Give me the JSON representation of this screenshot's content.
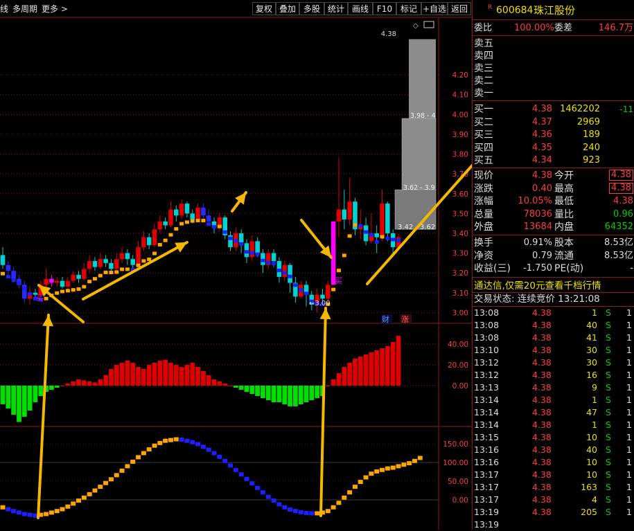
{
  "toolbar": {
    "left_items": [
      "线",
      "多周期",
      "更多 >"
    ],
    "buttons": [
      "复权",
      "叠加",
      "多股",
      "统计",
      "画线",
      "F10",
      "标记",
      "+自选",
      "返回"
    ]
  },
  "stock": {
    "code": "600684",
    "name": "珠江股份",
    "badge": "R"
  },
  "colors": {
    "up": "#ff3c3c",
    "down": "#00d2d2",
    "ma": "#ffa500",
    "macd_up": "#e00000",
    "macd_down": "#00e000",
    "grid": "#8b1a1a"
  },
  "order_book": {
    "weibi_label": "委比",
    "weibi_value": "100.00%",
    "weicha_label": "委差",
    "weicha_value": "146.7万",
    "sells": [
      "卖五",
      "卖四",
      "卖三",
      "卖二",
      "卖一"
    ],
    "buys": [
      {
        "label": "买一",
        "price": "4.38",
        "vol": "1462202",
        "chg": "-11"
      },
      {
        "label": "买二",
        "price": "4.37",
        "vol": "2969",
        "chg": ""
      },
      {
        "label": "买三",
        "price": "4.36",
        "vol": "189",
        "chg": ""
      },
      {
        "label": "买四",
        "price": "4.35",
        "vol": "240",
        "chg": ""
      },
      {
        "label": "买五",
        "price": "4.34",
        "vol": "923",
        "chg": ""
      }
    ]
  },
  "quote": [
    {
      "l1": "现价",
      "v1": "4.38",
      "l2": "今开",
      "v2": "4.38"
    },
    {
      "l1": "涨跌",
      "v1": "0.40",
      "l2": "最高",
      "v2": "4.38"
    },
    {
      "l1": "涨幅",
      "v1": "10.05%",
      "l2": "最低",
      "v2": "4.38"
    },
    {
      "l1": "总量",
      "v1": "78036",
      "l2": "量比",
      "v2": "0.96"
    },
    {
      "l1": "外盘",
      "v1": "13684",
      "l2": "内盘",
      "v2": "64352"
    },
    {
      "l1": "换手",
      "v1": "0.91%",
      "l2": "股本",
      "v2": "8.53亿"
    },
    {
      "l1": "净资",
      "v1": "0.79",
      "l2": "流通",
      "v2": "8.53亿"
    },
    {
      "l1": "收益(三)",
      "v1": "-1.750",
      "l2": "PE(动)",
      "v2": "-"
    }
  ],
  "ad_text": "通达信,仅需20元查看千档行情",
  "trade_status": "交易状态: 连续竞价 13:21:08",
  "ticks": [
    [
      "13:08",
      "4.38",
      "1",
      "S",
      "1"
    ],
    [
      "13:08",
      "4.38",
      "40",
      "S",
      "1"
    ],
    [
      "13:08",
      "4.38",
      "41",
      "S",
      "1"
    ],
    [
      "13:10",
      "4.38",
      "30",
      "S",
      "1"
    ],
    [
      "13:12",
      "4.38",
      "30",
      "S",
      "1"
    ],
    [
      "13:12",
      "4.38",
      "16",
      "S",
      "1"
    ],
    [
      "13:13",
      "4.38",
      "9",
      "S",
      "1"
    ],
    [
      "13:14",
      "4.38",
      "1",
      "S",
      "1"
    ],
    [
      "13:14",
      "4.38",
      "47",
      "S",
      "1"
    ],
    [
      "13:14",
      "4.38",
      "1",
      "S",
      "1"
    ],
    [
      "13:15",
      "4.38",
      "10",
      "S",
      "1"
    ],
    [
      "13:16",
      "4.38",
      "40",
      "S",
      "1"
    ],
    [
      "13:16",
      "4.38",
      "10",
      "S",
      "1"
    ],
    [
      "13:17",
      "4.38",
      "10",
      "S",
      "1"
    ],
    [
      "13:17",
      "4.38",
      "163",
      "S",
      "1"
    ],
    [
      "13:17",
      "4.38",
      "4",
      "S",
      "1"
    ],
    [
      "13:19",
      "4.38",
      "205",
      "S",
      "1"
    ],
    [
      "13:19",
      "",
      "",
      "",
      ""
    ]
  ],
  "chart_data": {
    "type": "candlestick",
    "price_ticks": [
      "4.20",
      "4.10",
      "4.00",
      "3.90",
      "3.80",
      "3.70",
      "3.60",
      "3.50",
      "3.40",
      "3.30",
      "3.20",
      "3.10",
      "3.00"
    ],
    "price_range": [
      2.97,
      4.48
    ],
    "labels": {
      "high": "4.38",
      "low": "3.00",
      "level1": "3.42",
      "level2": "3.62",
      "band1": "3.98 - 4",
      "band2": "3.62 - 3.9",
      "buy_mark": "买",
      "fin_mark": "财",
      "limit_mark": "涨"
    },
    "candles": [
      [
        3.29,
        3.24,
        3.33,
        3.22
      ],
      [
        3.24,
        3.21,
        3.26,
        3.18
      ],
      [
        3.21,
        3.17,
        3.23,
        3.15
      ],
      [
        3.17,
        3.14,
        3.19,
        3.12
      ],
      [
        3.14,
        3.07,
        3.16,
        3.05
      ],
      [
        3.07,
        3.1,
        3.13,
        3.04
      ],
      [
        3.1,
        3.09,
        3.12,
        3.07
      ],
      [
        3.09,
        3.14,
        3.16,
        3.08
      ],
      [
        3.14,
        3.17,
        3.22,
        3.12
      ],
      [
        3.17,
        3.15,
        3.19,
        3.13
      ],
      [
        3.15,
        3.16,
        3.18,
        3.13
      ],
      [
        3.16,
        3.13,
        3.18,
        3.12
      ],
      [
        3.13,
        3.16,
        3.18,
        3.11
      ],
      [
        3.16,
        3.19,
        3.21,
        3.15
      ],
      [
        3.19,
        3.17,
        3.21,
        3.15
      ],
      [
        3.17,
        3.22,
        3.25,
        3.16
      ],
      [
        3.22,
        3.26,
        3.29,
        3.2
      ],
      [
        3.26,
        3.23,
        3.28,
        3.21
      ],
      [
        3.23,
        3.27,
        3.3,
        3.22
      ],
      [
        3.27,
        3.25,
        3.29,
        3.23
      ],
      [
        3.25,
        3.22,
        3.27,
        3.2
      ],
      [
        3.22,
        3.27,
        3.3,
        3.21
      ],
      [
        3.27,
        3.3,
        3.33,
        3.25
      ],
      [
        3.3,
        3.27,
        3.32,
        3.24
      ],
      [
        3.27,
        3.24,
        3.29,
        3.22
      ],
      [
        3.24,
        3.33,
        3.36,
        3.23
      ],
      [
        3.33,
        3.38,
        3.41,
        3.31
      ],
      [
        3.38,
        3.34,
        3.4,
        3.32
      ],
      [
        3.34,
        3.42,
        3.45,
        3.33
      ],
      [
        3.42,
        3.46,
        3.49,
        3.4
      ],
      [
        3.46,
        3.44,
        3.48,
        3.42
      ],
      [
        3.44,
        3.52,
        3.56,
        3.43
      ],
      [
        3.52,
        3.49,
        3.54,
        3.46
      ],
      [
        3.49,
        3.55,
        3.57,
        3.47
      ],
      [
        3.55,
        3.5,
        3.56,
        3.48
      ],
      [
        3.5,
        3.47,
        3.52,
        3.45
      ],
      [
        3.47,
        3.53,
        3.55,
        3.46
      ],
      [
        3.53,
        3.49,
        3.55,
        3.47
      ],
      [
        3.49,
        3.46,
        3.52,
        3.44
      ],
      [
        3.46,
        3.43,
        3.48,
        3.4
      ],
      [
        3.43,
        3.48,
        3.5,
        3.41
      ],
      [
        3.48,
        3.39,
        3.49,
        3.37
      ],
      [
        3.39,
        3.33,
        3.41,
        3.31
      ],
      [
        3.33,
        3.4,
        3.43,
        3.31
      ],
      [
        3.4,
        3.35,
        3.42,
        3.3
      ],
      [
        3.35,
        3.28,
        3.37,
        3.25
      ],
      [
        3.28,
        3.36,
        3.39,
        3.26
      ],
      [
        3.36,
        3.3,
        3.38,
        3.28
      ],
      [
        3.3,
        3.24,
        3.32,
        3.2
      ],
      [
        3.24,
        3.3,
        3.32,
        3.22
      ],
      [
        3.3,
        3.26,
        3.32,
        3.23
      ],
      [
        3.26,
        3.18,
        3.28,
        3.15
      ],
      [
        3.18,
        3.24,
        3.26,
        3.16
      ],
      [
        3.24,
        3.15,
        3.25,
        3.1
      ],
      [
        3.15,
        3.08,
        3.18,
        3.05
      ],
      [
        3.08,
        3.14,
        3.16,
        3.07
      ],
      [
        3.14,
        3.09,
        3.16,
        3.03
      ],
      [
        3.09,
        3.04,
        3.11,
        3.01
      ],
      [
        3.04,
        3.09,
        3.12,
        3.0
      ],
      [
        3.09,
        3.07,
        3.12,
        3.04
      ],
      [
        3.07,
        3.14,
        3.16,
        3.06
      ],
      [
        3.14,
        3.46,
        3.46,
        3.14
      ],
      [
        3.46,
        3.52,
        3.78,
        3.38
      ],
      [
        3.52,
        3.47,
        3.62,
        3.42
      ],
      [
        3.47,
        3.56,
        3.68,
        3.44
      ],
      [
        3.56,
        3.42,
        3.58,
        3.39
      ],
      [
        3.42,
        3.44,
        3.52,
        3.37
      ],
      [
        3.44,
        3.36,
        3.48,
        3.34
      ],
      [
        3.36,
        3.4,
        3.5,
        3.35
      ],
      [
        3.4,
        3.38,
        3.44,
        3.3
      ],
      [
        3.38,
        3.55,
        3.62,
        3.36
      ],
      [
        3.55,
        3.4,
        3.56,
        3.36
      ],
      [
        3.4,
        3.33,
        3.42,
        3.28
      ],
      [
        3.33,
        3.38,
        3.4,
        3.32
      ]
    ],
    "macd_ticks": [
      "40.00",
      "20.00",
      "0.00"
    ],
    "macd": [
      -18,
      -22,
      -28,
      -35,
      -30,
      -24,
      -16,
      -10,
      -6,
      -4,
      -2,
      0,
      2,
      4,
      6,
      5,
      4,
      3,
      6,
      10,
      16,
      20,
      22,
      24,
      22,
      18,
      16,
      20,
      22,
      24,
      25,
      22,
      20,
      18,
      20,
      22,
      18,
      14,
      10,
      6,
      4,
      2,
      0,
      -2,
      -4,
      -6,
      -8,
      -10,
      -12,
      -14,
      -16,
      -16,
      -18,
      -20,
      -20,
      -18,
      -16,
      -14,
      -12,
      -10,
      0,
      6,
      12,
      18,
      22,
      26,
      28,
      30,
      32,
      34,
      36,
      38,
      42,
      48
    ],
    "osc_ticks": [
      "150.00",
      "100.00",
      "50.00",
      "0.00"
    ],
    "osc": [
      -20,
      -25,
      -30,
      -34,
      -38,
      -40,
      -42,
      -40,
      -38,
      -34,
      -30,
      -25,
      -18,
      -10,
      -2,
      6,
      15,
      25,
      35,
      45,
      55,
      66,
      78,
      90,
      102,
      114,
      125,
      135,
      145,
      152,
      158,
      160,
      162,
      161,
      158,
      154,
      149,
      142,
      134,
      125,
      115,
      104,
      92,
      80,
      68,
      56,
      44,
      32,
      20,
      8,
      -2,
      -12,
      -20,
      -26,
      -30,
      -33,
      -35,
      -36,
      -36,
      -34,
      -30,
      -20,
      -8,
      6,
      20,
      35,
      48,
      60,
      70,
      76,
      80,
      84,
      86,
      90,
      94,
      98,
      104,
      112
    ]
  }
}
